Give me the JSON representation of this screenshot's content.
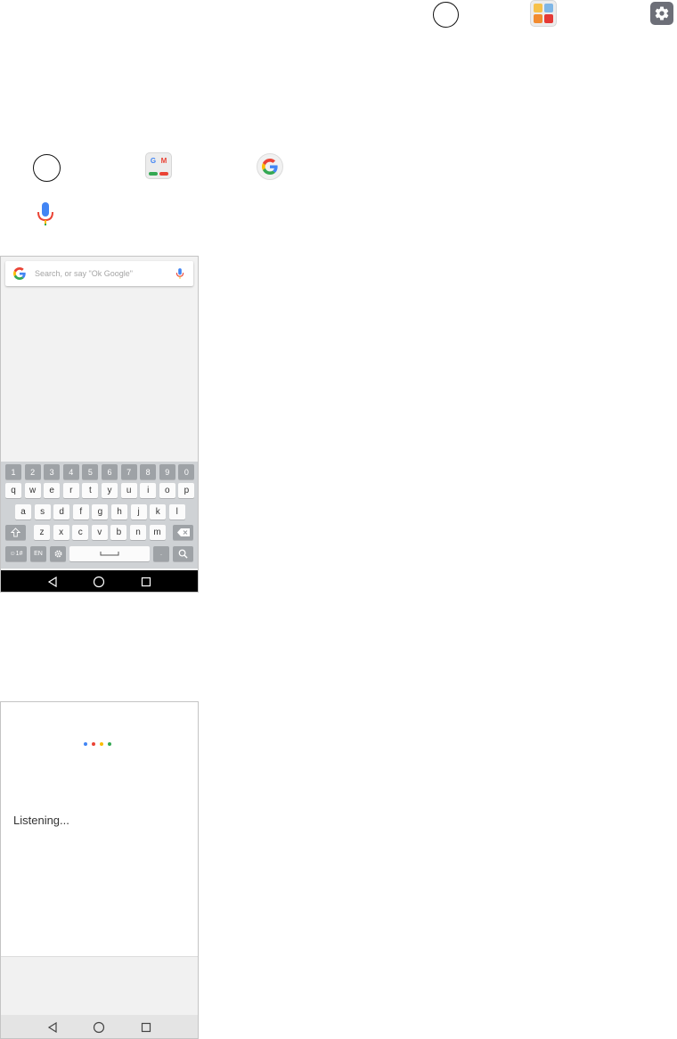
{
  "search": {
    "placeholder": "Search, or say \"Ok Google\""
  },
  "keyboard": {
    "numbers": [
      "1",
      "2",
      "3",
      "4",
      "5",
      "6",
      "7",
      "8",
      "9",
      "0"
    ],
    "row1": [
      "q",
      "w",
      "e",
      "r",
      "t",
      "y",
      "u",
      "i",
      "o",
      "p"
    ],
    "row2": [
      "a",
      "s",
      "d",
      "f",
      "g",
      "h",
      "j",
      "k",
      "l"
    ],
    "row3": [
      "z",
      "x",
      "c",
      "v",
      "b",
      "n",
      "m"
    ],
    "symbols_label": "☺1#",
    "lang_label": "EN",
    "period_label": "."
  },
  "voice": {
    "status": "Listening..."
  },
  "colors": {
    "google_blue": "#4285F4",
    "google_red": "#EA4335",
    "google_yellow": "#FBBC05",
    "google_green": "#34A853"
  },
  "icons": [
    "circle-icon",
    "app-folder-icon",
    "settings-gear-icon",
    "google-apps-folder-icon",
    "google-logo-icon",
    "microphone-icon",
    "backspace-icon",
    "shift-icon",
    "search-icon",
    "back-icon",
    "home-icon",
    "recents-icon"
  ]
}
